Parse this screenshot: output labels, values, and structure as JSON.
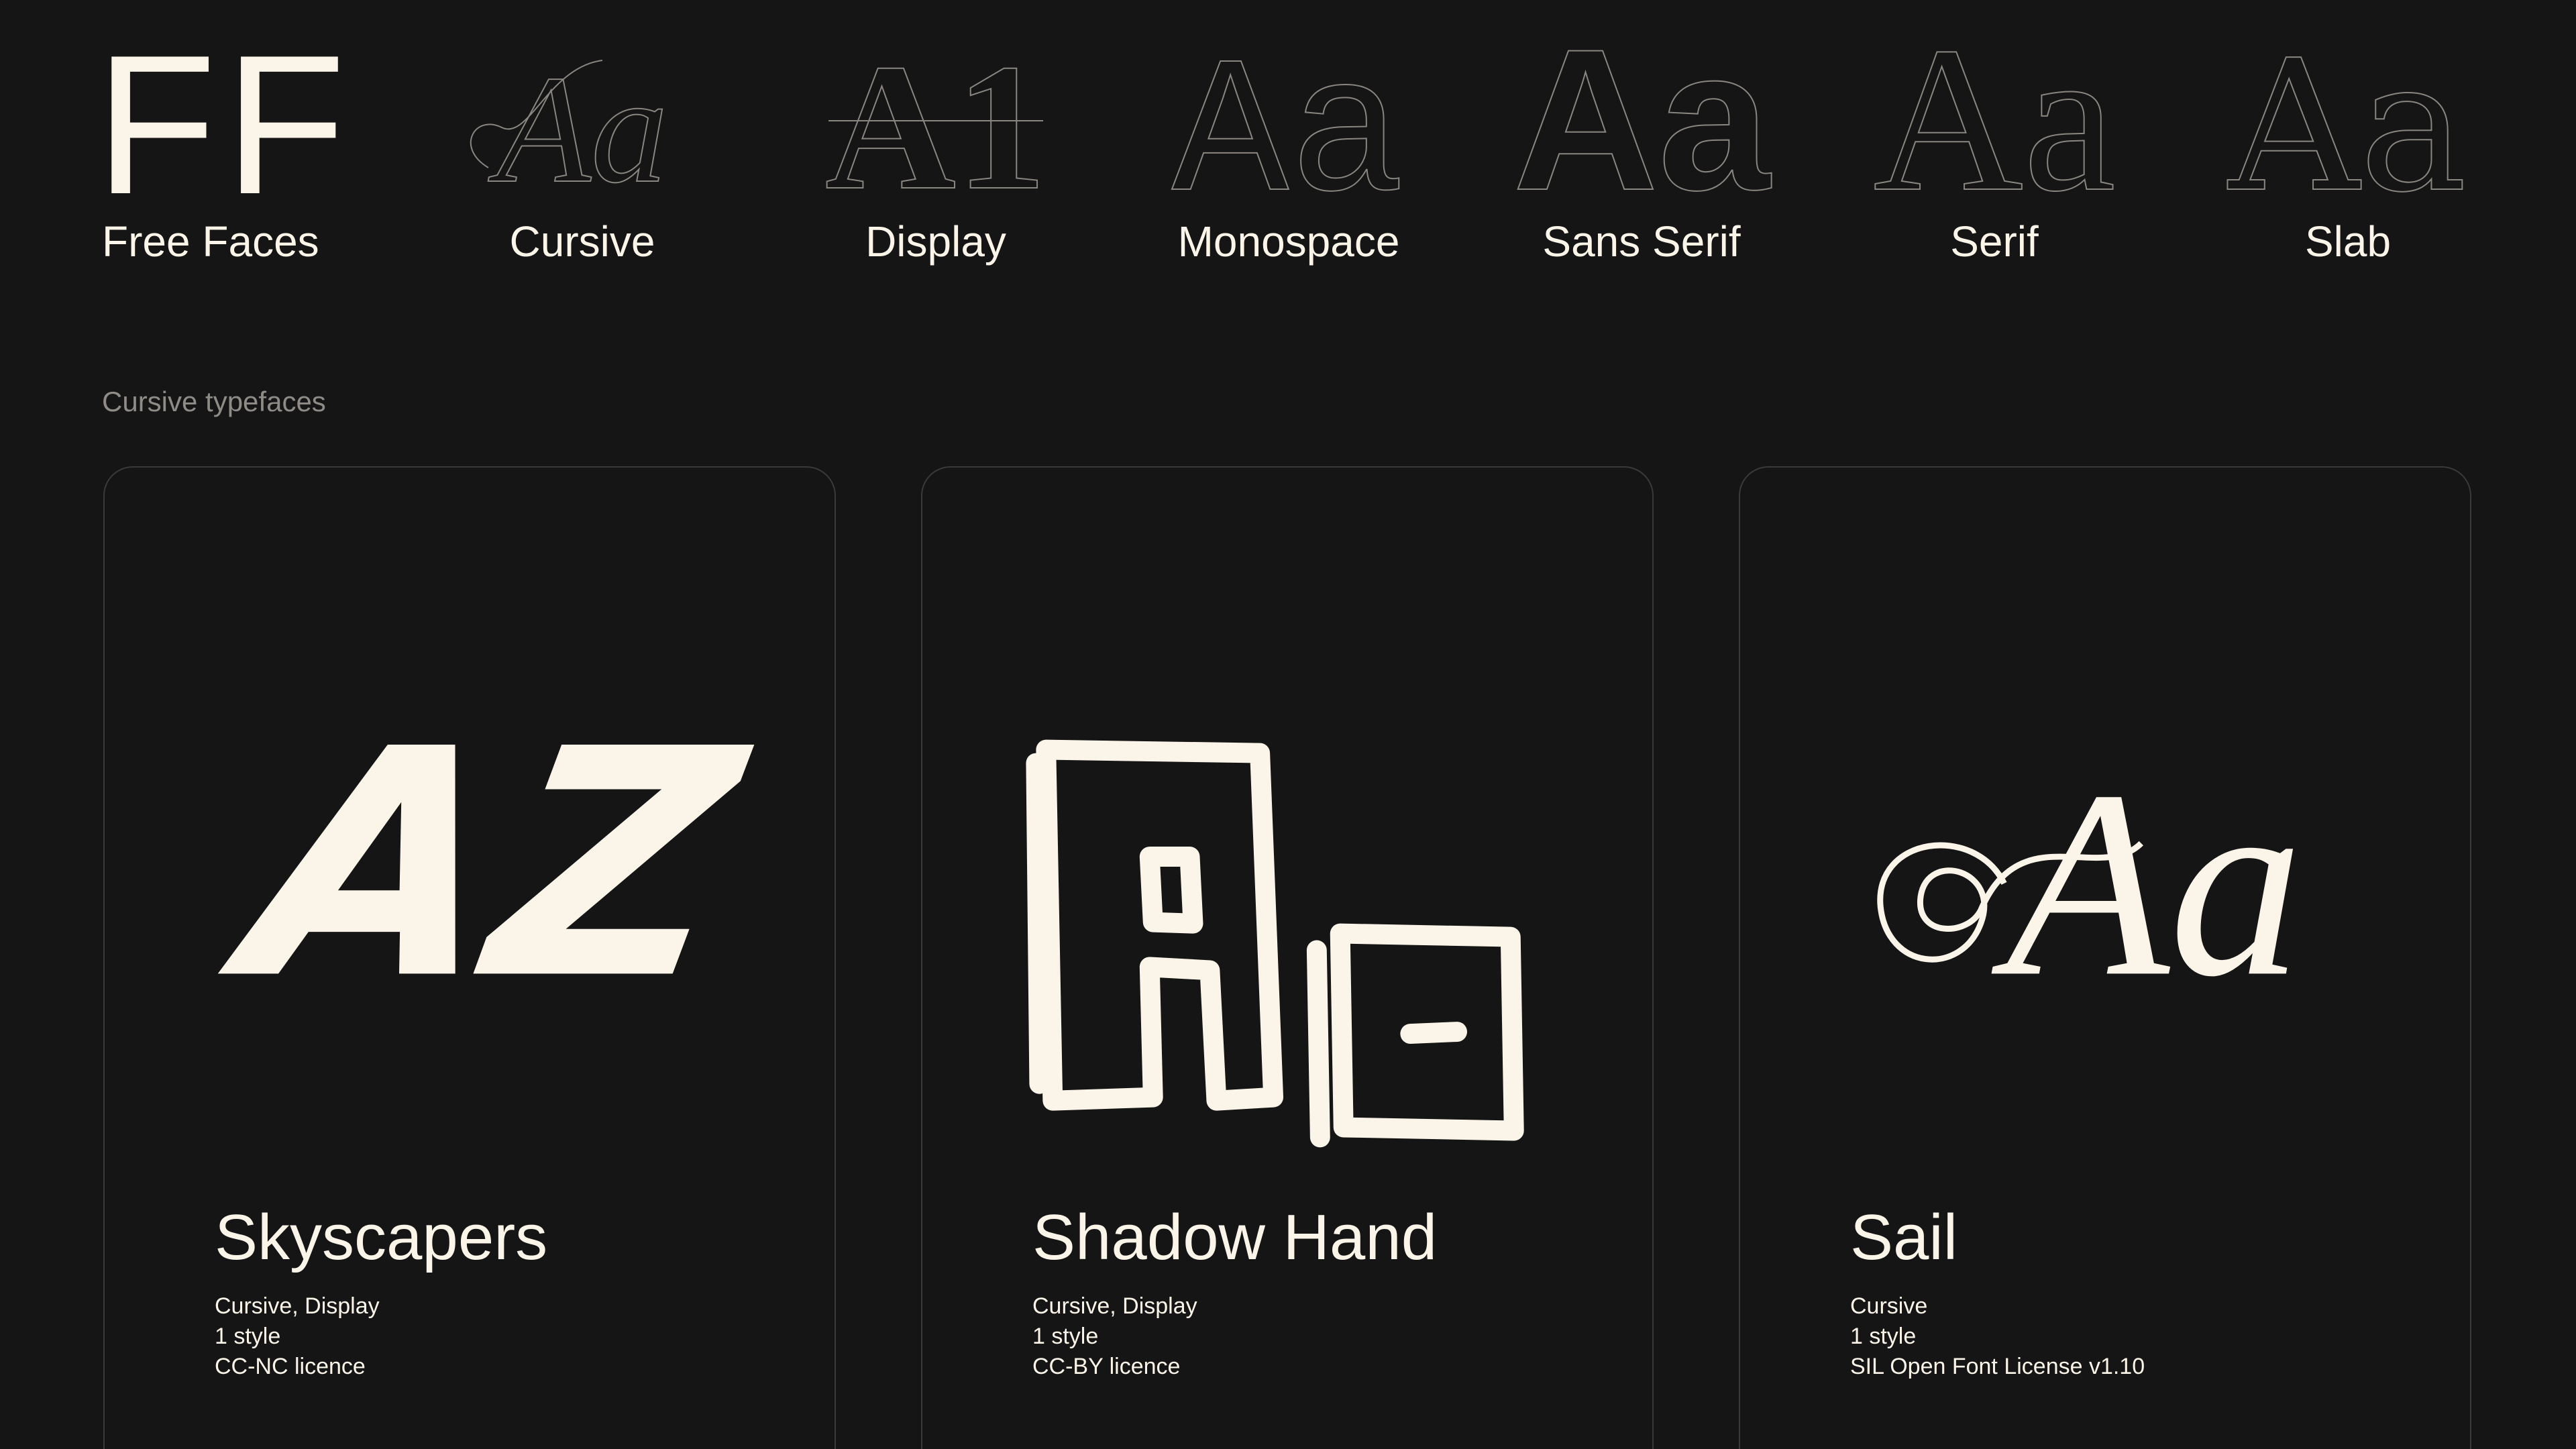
{
  "logo": {
    "mark": "FF",
    "label": "Free Faces"
  },
  "categories": [
    {
      "label": "Cursive",
      "sample": "Aa"
    },
    {
      "label": "Display",
      "sample": "A1"
    },
    {
      "label": "Monospace",
      "sample": "Aa"
    },
    {
      "label": "Sans Serif",
      "sample": "Aa"
    },
    {
      "label": "Serif",
      "sample": "Aa"
    },
    {
      "label": "Slab",
      "sample": "Aa"
    }
  ],
  "section": {
    "title": "Cursive typefaces"
  },
  "cards": [
    {
      "sample": "AZ",
      "name": "Skyscapers",
      "tags": "Cursive, Display",
      "styles": "1 style",
      "license": "CC-NC licence"
    },
    {
      "sample": "AE",
      "name": "Shadow Hand",
      "tags": "Cursive, Display",
      "styles": "1 style",
      "license": "CC-BY licence"
    },
    {
      "sample": "Aa",
      "name": "Sail",
      "tags": "Cursive",
      "styles": "1 style",
      "license": "SIL Open Font License v1.10"
    }
  ],
  "colors": {
    "background": "#151515",
    "text": "#fbf4e8",
    "muted": "#8f8c87",
    "border": "#3a3a3a"
  }
}
